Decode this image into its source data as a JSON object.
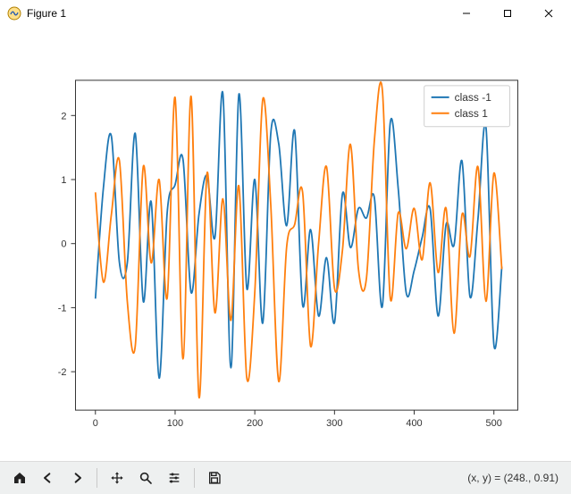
{
  "window": {
    "title": "Figure 1"
  },
  "toolbar": {
    "cursor_readout": "(x, y) = (248., 0.91)"
  },
  "chart_data": {
    "type": "line",
    "xlabel": "",
    "ylabel": "",
    "xlim": [
      -25,
      530
    ],
    "ylim": [
      -2.6,
      2.55
    ],
    "xticks": [
      0,
      100,
      200,
      300,
      400,
      500
    ],
    "yticks": [
      -2,
      -1,
      0,
      1,
      2
    ],
    "legend_position": "upper right",
    "colors": {
      "class -1": "#1f77b4",
      "class 1": "#ff7f0e"
    },
    "x": [
      0,
      10,
      20,
      30,
      40,
      50,
      60,
      70,
      80,
      90,
      100,
      110,
      120,
      130,
      140,
      150,
      160,
      170,
      180,
      190,
      200,
      210,
      220,
      230,
      240,
      250,
      260,
      270,
      280,
      290,
      300,
      310,
      320,
      330,
      340,
      350,
      360,
      370,
      380,
      390,
      400,
      410,
      420,
      430,
      440,
      450,
      460,
      470,
      480,
      490,
      500,
      510
    ],
    "series": [
      {
        "name": "class -1",
        "values": [
          -0.86,
          0.87,
          1.68,
          -0.29,
          -0.3,
          1.72,
          -0.9,
          0.65,
          -2.1,
          0.48,
          0.92,
          1.31,
          -0.76,
          0.46,
          1.06,
          0.1,
          2.34,
          -1.94,
          2.33,
          -0.7,
          1.0,
          -1.24,
          1.72,
          1.56,
          0.28,
          1.76,
          -0.96,
          0.22,
          -1.13,
          -0.22,
          -1.23,
          0.78,
          -0.06,
          0.55,
          0.4,
          0.72,
          -0.98,
          1.89,
          0.86,
          -0.77,
          -0.42,
          0.1,
          0.54,
          -1.13,
          0.3,
          -0.02,
          1.29,
          -0.83,
          0.38,
          1.82,
          -1.58,
          -0.36
        ]
      },
      {
        "name": "class 1",
        "values": [
          0.8,
          -0.6,
          0.45,
          1.3,
          -0.9,
          -1.6,
          1.2,
          -0.3,
          1.0,
          -0.85,
          2.28,
          -1.8,
          2.3,
          -2.4,
          1.1,
          -1.08,
          0.7,
          -1.2,
          0.9,
          -2.1,
          -0.75,
          2.25,
          0.6,
          -2.15,
          -0.05,
          0.3,
          0.8,
          -1.6,
          0.0,
          1.2,
          -0.7,
          -0.1,
          1.55,
          -0.4,
          -0.55,
          1.6,
          2.4,
          -0.85,
          0.48,
          -0.08,
          0.55,
          -0.25,
          0.95,
          -0.45,
          0.55,
          -1.4,
          0.45,
          -0.2,
          1.2,
          -0.9,
          1.1,
          -0.4
        ]
      }
    ]
  }
}
